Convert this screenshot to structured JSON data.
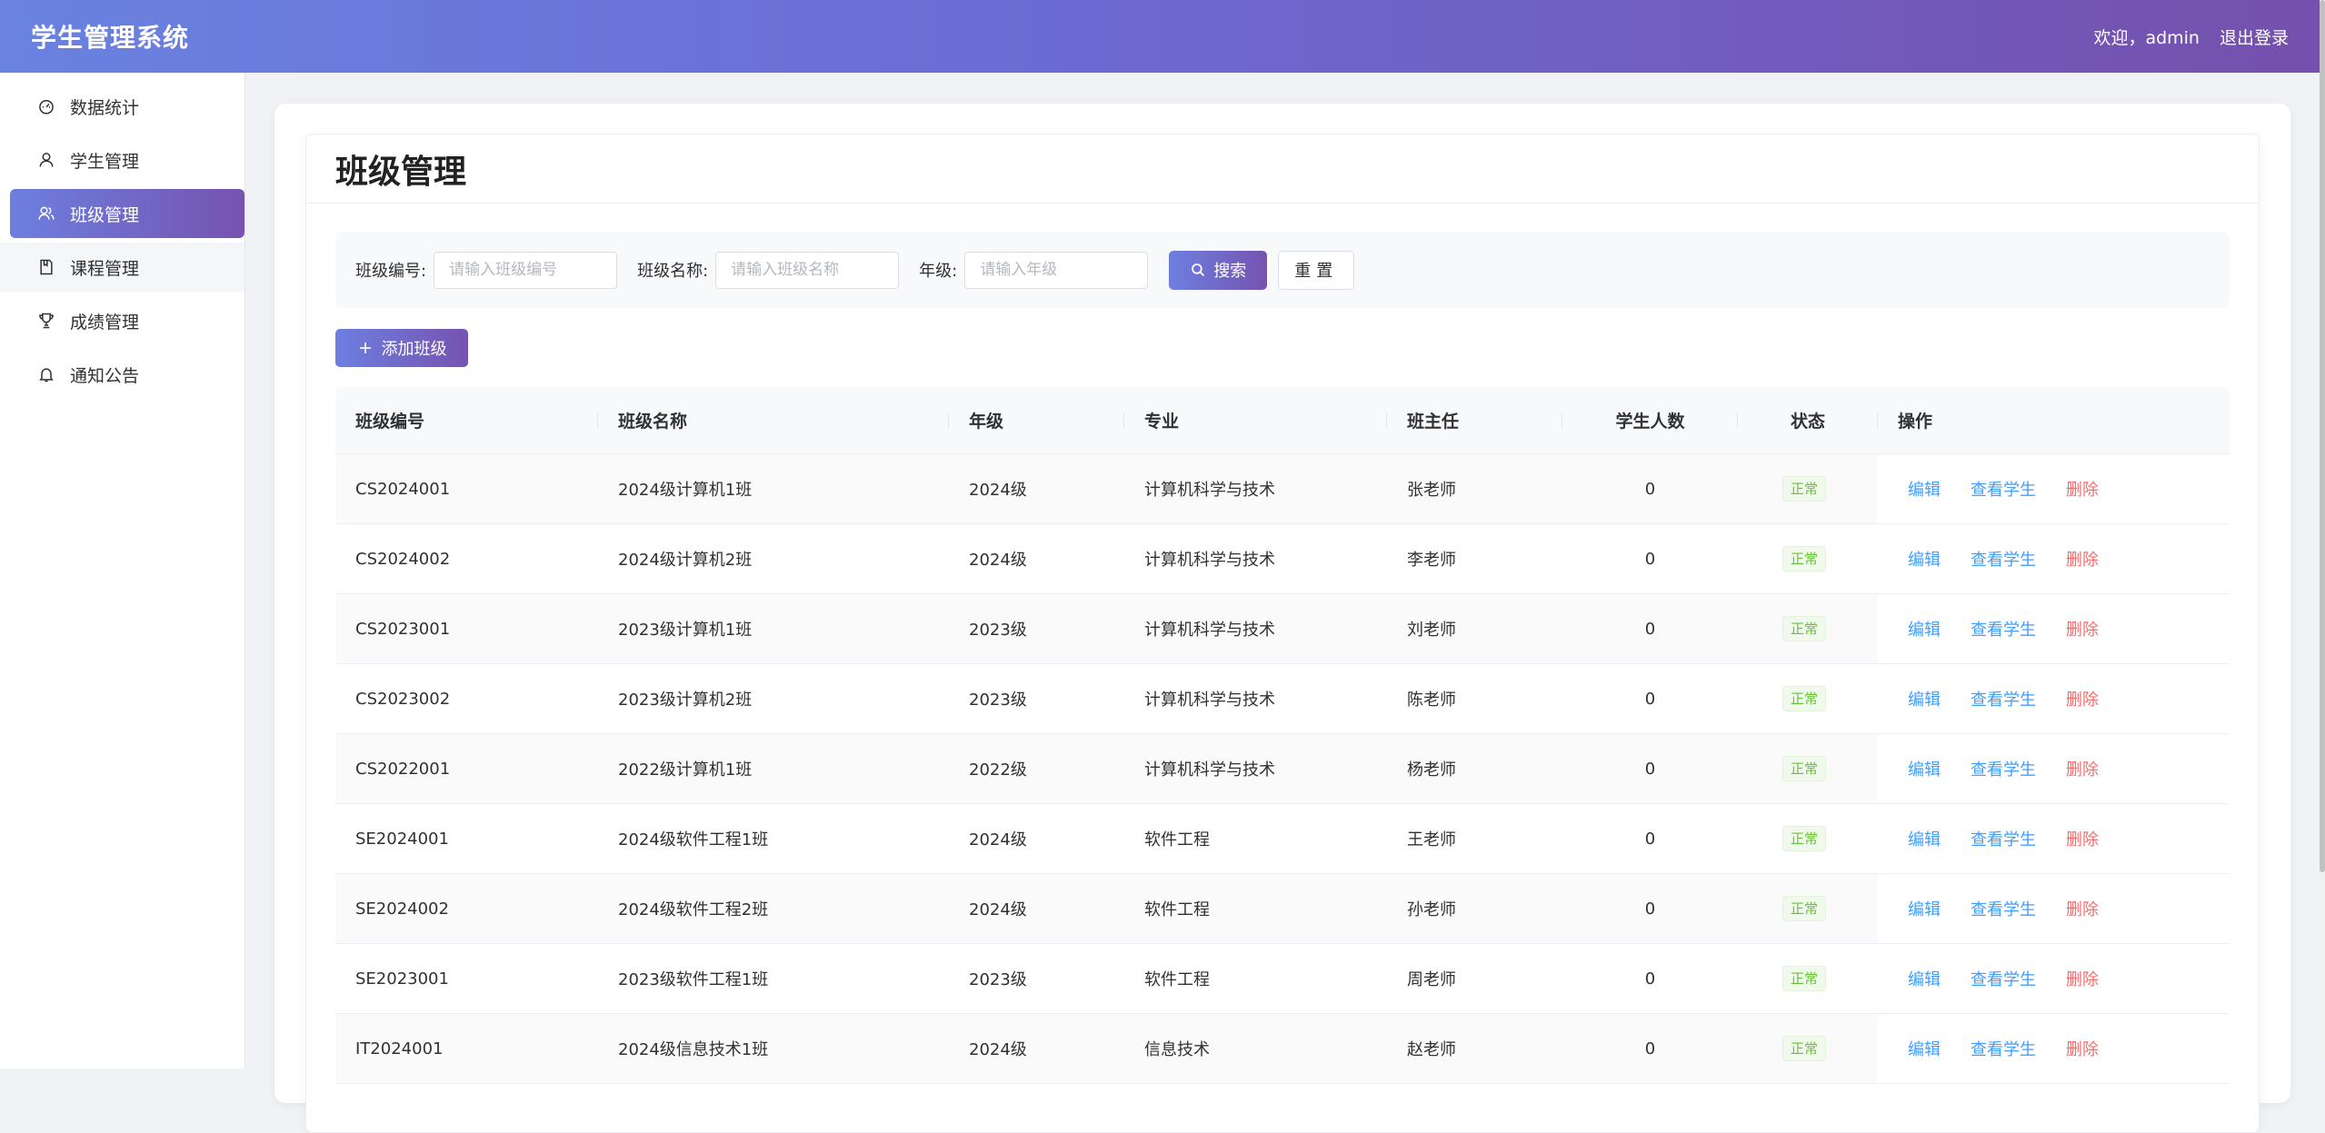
{
  "header": {
    "brand": "学生管理系统",
    "welcome": "欢迎，admin",
    "logout": "退出登录"
  },
  "sidebar": {
    "items": [
      {
        "label": "数据统计",
        "icon": "dashboard-icon"
      },
      {
        "label": "学生管理",
        "icon": "user-icon"
      },
      {
        "label": "班级管理",
        "icon": "users-icon",
        "active": true
      },
      {
        "label": "课程管理",
        "icon": "book-icon"
      },
      {
        "label": "成绩管理",
        "icon": "trophy-icon"
      },
      {
        "label": "通知公告",
        "icon": "bell-icon"
      }
    ]
  },
  "page": {
    "title": "班级管理"
  },
  "search": {
    "code_label": "班级编号:",
    "code_placeholder": "请输入班级编号",
    "name_label": "班级名称:",
    "name_placeholder": "请输入班级名称",
    "grade_label": "年级:",
    "grade_placeholder": "请输入年级",
    "search_button": "搜索",
    "reset_button": "重置"
  },
  "toolbar": {
    "add_button": "添加班级"
  },
  "table": {
    "columns": [
      "班级编号",
      "班级名称",
      "年级",
      "专业",
      "班主任",
      "学生人数",
      "状态",
      "操作"
    ],
    "actions": {
      "edit": "编辑",
      "view": "查看学生",
      "delete": "删除"
    },
    "rows": [
      {
        "code": "CS2024001",
        "name": "2024级计算机1班",
        "grade": "2024级",
        "major": "计算机科学与技术",
        "teacher": "张老师",
        "count": "0",
        "status": "正常"
      },
      {
        "code": "CS2024002",
        "name": "2024级计算机2班",
        "grade": "2024级",
        "major": "计算机科学与技术",
        "teacher": "李老师",
        "count": "0",
        "status": "正常"
      },
      {
        "code": "CS2023001",
        "name": "2023级计算机1班",
        "grade": "2023级",
        "major": "计算机科学与技术",
        "teacher": "刘老师",
        "count": "0",
        "status": "正常"
      },
      {
        "code": "CS2023002",
        "name": "2023级计算机2班",
        "grade": "2023级",
        "major": "计算机科学与技术",
        "teacher": "陈老师",
        "count": "0",
        "status": "正常"
      },
      {
        "code": "CS2022001",
        "name": "2022级计算机1班",
        "grade": "2022级",
        "major": "计算机科学与技术",
        "teacher": "杨老师",
        "count": "0",
        "status": "正常"
      },
      {
        "code": "SE2024001",
        "name": "2024级软件工程1班",
        "grade": "2024级",
        "major": "软件工程",
        "teacher": "王老师",
        "count": "0",
        "status": "正常"
      },
      {
        "code": "SE2024002",
        "name": "2024级软件工程2班",
        "grade": "2024级",
        "major": "软件工程",
        "teacher": "孙老师",
        "count": "0",
        "status": "正常"
      },
      {
        "code": "SE2023001",
        "name": "2023级软件工程1班",
        "grade": "2023级",
        "major": "软件工程",
        "teacher": "周老师",
        "count": "0",
        "status": "正常"
      },
      {
        "code": "IT2024001",
        "name": "2024级信息技术1班",
        "grade": "2024级",
        "major": "信息技术",
        "teacher": "赵老师",
        "count": "0",
        "status": "正常"
      }
    ]
  }
}
